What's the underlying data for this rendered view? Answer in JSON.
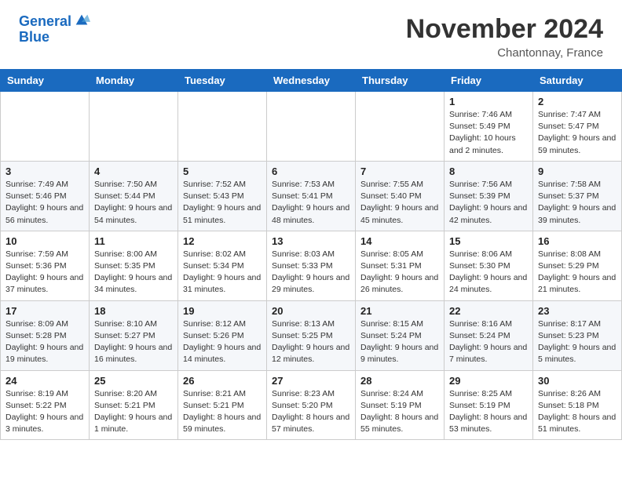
{
  "header": {
    "logo_line1": "General",
    "logo_line2": "Blue",
    "month": "November 2024",
    "location": "Chantonnay, France"
  },
  "weekdays": [
    "Sunday",
    "Monday",
    "Tuesday",
    "Wednesday",
    "Thursday",
    "Friday",
    "Saturday"
  ],
  "weeks": [
    [
      {
        "day": "",
        "sunrise": "",
        "sunset": "",
        "daylight": ""
      },
      {
        "day": "",
        "sunrise": "",
        "sunset": "",
        "daylight": ""
      },
      {
        "day": "",
        "sunrise": "",
        "sunset": "",
        "daylight": ""
      },
      {
        "day": "",
        "sunrise": "",
        "sunset": "",
        "daylight": ""
      },
      {
        "day": "",
        "sunrise": "",
        "sunset": "",
        "daylight": ""
      },
      {
        "day": "1",
        "sunrise": "Sunrise: 7:46 AM",
        "sunset": "Sunset: 5:49 PM",
        "daylight": "Daylight: 10 hours and 2 minutes."
      },
      {
        "day": "2",
        "sunrise": "Sunrise: 7:47 AM",
        "sunset": "Sunset: 5:47 PM",
        "daylight": "Daylight: 9 hours and 59 minutes."
      }
    ],
    [
      {
        "day": "3",
        "sunrise": "Sunrise: 7:49 AM",
        "sunset": "Sunset: 5:46 PM",
        "daylight": "Daylight: 9 hours and 56 minutes."
      },
      {
        "day": "4",
        "sunrise": "Sunrise: 7:50 AM",
        "sunset": "Sunset: 5:44 PM",
        "daylight": "Daylight: 9 hours and 54 minutes."
      },
      {
        "day": "5",
        "sunrise": "Sunrise: 7:52 AM",
        "sunset": "Sunset: 5:43 PM",
        "daylight": "Daylight: 9 hours and 51 minutes."
      },
      {
        "day": "6",
        "sunrise": "Sunrise: 7:53 AM",
        "sunset": "Sunset: 5:41 PM",
        "daylight": "Daylight: 9 hours and 48 minutes."
      },
      {
        "day": "7",
        "sunrise": "Sunrise: 7:55 AM",
        "sunset": "Sunset: 5:40 PM",
        "daylight": "Daylight: 9 hours and 45 minutes."
      },
      {
        "day": "8",
        "sunrise": "Sunrise: 7:56 AM",
        "sunset": "Sunset: 5:39 PM",
        "daylight": "Daylight: 9 hours and 42 minutes."
      },
      {
        "day": "9",
        "sunrise": "Sunrise: 7:58 AM",
        "sunset": "Sunset: 5:37 PM",
        "daylight": "Daylight: 9 hours and 39 minutes."
      }
    ],
    [
      {
        "day": "10",
        "sunrise": "Sunrise: 7:59 AM",
        "sunset": "Sunset: 5:36 PM",
        "daylight": "Daylight: 9 hours and 37 minutes."
      },
      {
        "day": "11",
        "sunrise": "Sunrise: 8:00 AM",
        "sunset": "Sunset: 5:35 PM",
        "daylight": "Daylight: 9 hours and 34 minutes."
      },
      {
        "day": "12",
        "sunrise": "Sunrise: 8:02 AM",
        "sunset": "Sunset: 5:34 PM",
        "daylight": "Daylight: 9 hours and 31 minutes."
      },
      {
        "day": "13",
        "sunrise": "Sunrise: 8:03 AM",
        "sunset": "Sunset: 5:33 PM",
        "daylight": "Daylight: 9 hours and 29 minutes."
      },
      {
        "day": "14",
        "sunrise": "Sunrise: 8:05 AM",
        "sunset": "Sunset: 5:31 PM",
        "daylight": "Daylight: 9 hours and 26 minutes."
      },
      {
        "day": "15",
        "sunrise": "Sunrise: 8:06 AM",
        "sunset": "Sunset: 5:30 PM",
        "daylight": "Daylight: 9 hours and 24 minutes."
      },
      {
        "day": "16",
        "sunrise": "Sunrise: 8:08 AM",
        "sunset": "Sunset: 5:29 PM",
        "daylight": "Daylight: 9 hours and 21 minutes."
      }
    ],
    [
      {
        "day": "17",
        "sunrise": "Sunrise: 8:09 AM",
        "sunset": "Sunset: 5:28 PM",
        "daylight": "Daylight: 9 hours and 19 minutes."
      },
      {
        "day": "18",
        "sunrise": "Sunrise: 8:10 AM",
        "sunset": "Sunset: 5:27 PM",
        "daylight": "Daylight: 9 hours and 16 minutes."
      },
      {
        "day": "19",
        "sunrise": "Sunrise: 8:12 AM",
        "sunset": "Sunset: 5:26 PM",
        "daylight": "Daylight: 9 hours and 14 minutes."
      },
      {
        "day": "20",
        "sunrise": "Sunrise: 8:13 AM",
        "sunset": "Sunset: 5:25 PM",
        "daylight": "Daylight: 9 hours and 12 minutes."
      },
      {
        "day": "21",
        "sunrise": "Sunrise: 8:15 AM",
        "sunset": "Sunset: 5:24 PM",
        "daylight": "Daylight: 9 hours and 9 minutes."
      },
      {
        "day": "22",
        "sunrise": "Sunrise: 8:16 AM",
        "sunset": "Sunset: 5:24 PM",
        "daylight": "Daylight: 9 hours and 7 minutes."
      },
      {
        "day": "23",
        "sunrise": "Sunrise: 8:17 AM",
        "sunset": "Sunset: 5:23 PM",
        "daylight": "Daylight: 9 hours and 5 minutes."
      }
    ],
    [
      {
        "day": "24",
        "sunrise": "Sunrise: 8:19 AM",
        "sunset": "Sunset: 5:22 PM",
        "daylight": "Daylight: 9 hours and 3 minutes."
      },
      {
        "day": "25",
        "sunrise": "Sunrise: 8:20 AM",
        "sunset": "Sunset: 5:21 PM",
        "daylight": "Daylight: 9 hours and 1 minute."
      },
      {
        "day": "26",
        "sunrise": "Sunrise: 8:21 AM",
        "sunset": "Sunset: 5:21 PM",
        "daylight": "Daylight: 8 hours and 59 minutes."
      },
      {
        "day": "27",
        "sunrise": "Sunrise: 8:23 AM",
        "sunset": "Sunset: 5:20 PM",
        "daylight": "Daylight: 8 hours and 57 minutes."
      },
      {
        "day": "28",
        "sunrise": "Sunrise: 8:24 AM",
        "sunset": "Sunset: 5:19 PM",
        "daylight": "Daylight: 8 hours and 55 minutes."
      },
      {
        "day": "29",
        "sunrise": "Sunrise: 8:25 AM",
        "sunset": "Sunset: 5:19 PM",
        "daylight": "Daylight: 8 hours and 53 minutes."
      },
      {
        "day": "30",
        "sunrise": "Sunrise: 8:26 AM",
        "sunset": "Sunset: 5:18 PM",
        "daylight": "Daylight: 8 hours and 51 minutes."
      }
    ]
  ]
}
